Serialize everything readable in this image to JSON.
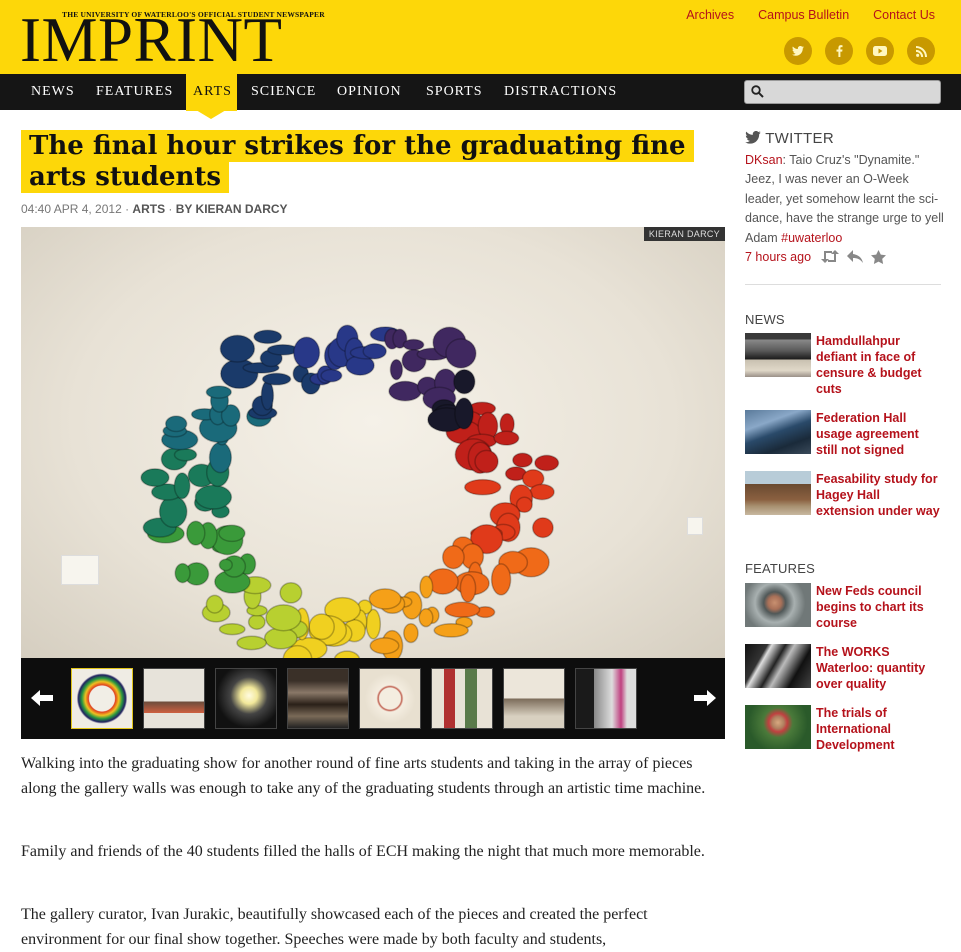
{
  "masthead": {
    "tagline": "THE UNIVERSITY OF WATERLOO'S OFFICIAL STUDENT NEWSPAPER",
    "logo": "IMPRINT",
    "links": [
      "Archives",
      "Campus Bulletin",
      "Contact Us"
    ],
    "social_icons": [
      "twitter-icon",
      "facebook-icon",
      "youtube-icon",
      "rss-icon"
    ]
  },
  "nav": {
    "items": [
      "NEWS",
      "FEATURES",
      "ARTS",
      "SCIENCE",
      "OPINION",
      "SPORTS",
      "DISTRACTIONS"
    ],
    "active": "ARTS",
    "search_placeholder": ""
  },
  "article": {
    "title": "The final hour strikes for the graduating fine arts students",
    "time": "04:40 APR 4, 2012",
    "section": "ARTS",
    "byline": "BY KIERAN DARCY",
    "photo_credit": "KIERAN DARCY",
    "paragraphs": [
      "Walking into the graduating show for another round of fine arts students and taking in the array of pieces along the gallery walls was enough to take any of the graduating students through an artistic time machine.",
      "Family and friends of the 40 students filled the halls of ECH making the night that much more memorable.",
      "The gallery curator, Ivan Jurakic, beautifully showcased each of the pieces and created the perfect environment for our final show together.  Speeches were made by both faculty and students,"
    ]
  },
  "gallery": {
    "thumb_count": 8,
    "selected_index": 0
  },
  "sidebar": {
    "twitter": {
      "heading": "TWITTER",
      "user": "DKsan",
      "text": ": Taio Cruz's \"Dynamite.\" Jeez, I was never an O-Week leader, yet somehow learnt the sci-dance, have the strange urge to yell Adam ",
      "hashtag": "#uwaterloo",
      "time": "7 hours ago"
    },
    "news": {
      "heading": "NEWS",
      "items": [
        "Hamdullahpur defiant in face of censure & budget cuts",
        "Federation Hall usage agreement still not signed",
        "Feasability study for Hagey Hall extension under way"
      ]
    },
    "features": {
      "heading": "FEATURES",
      "items": [
        "New Feds council begins to chart its course",
        "The WORKS Waterloo: quantity over quality",
        "The trials of International Development"
      ]
    }
  }
}
